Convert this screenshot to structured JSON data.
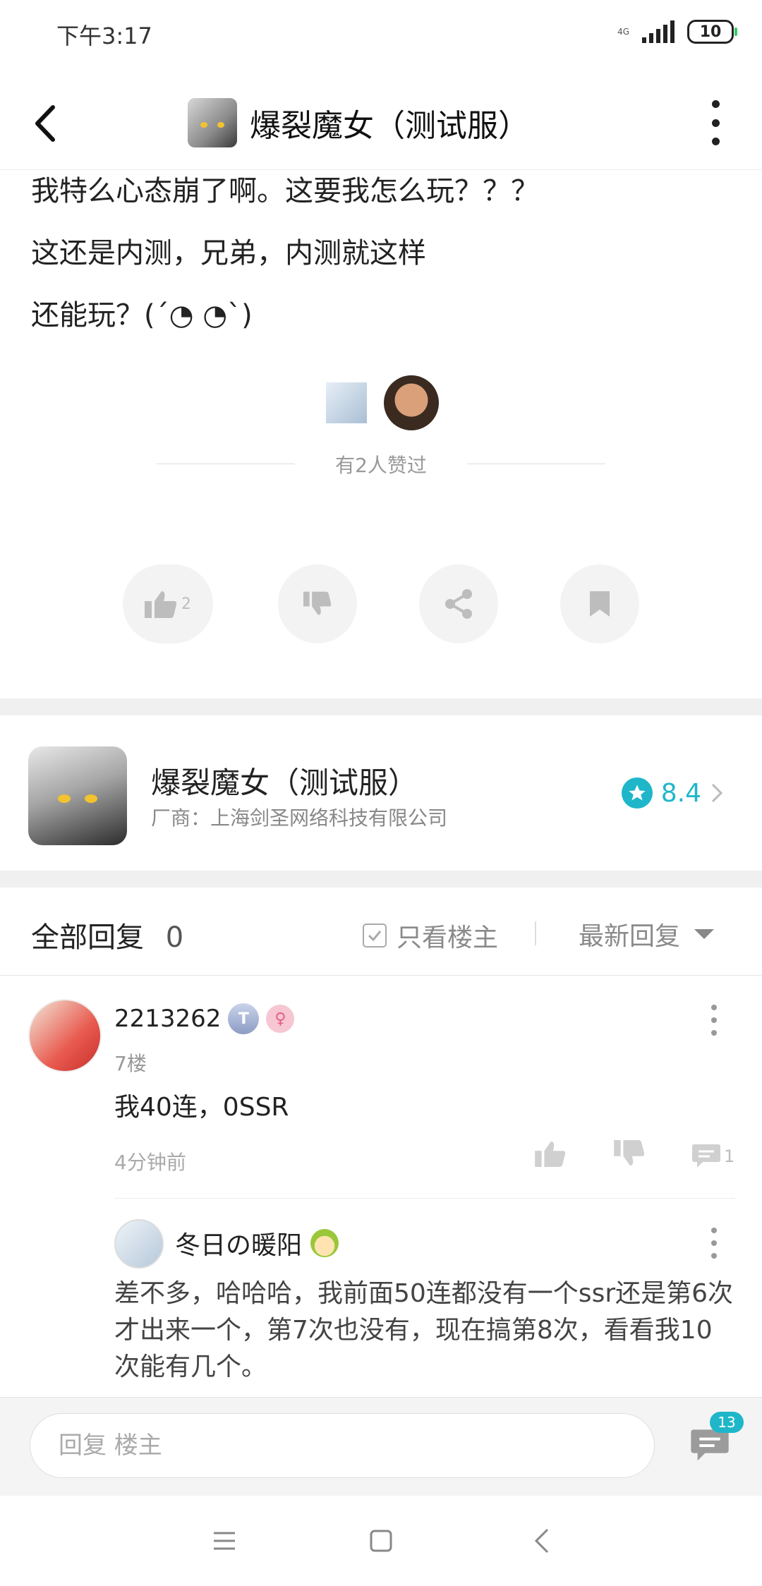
{
  "status_bar": {
    "time": "下午3:17",
    "network": "4G",
    "battery": "10"
  },
  "header": {
    "title": "爆裂魔女（测试服）"
  },
  "post": {
    "lines": [
      "我特么心态崩了啊。这要我怎么玩？？？",
      "这还是内测，兄弟，内测就这样",
      "还能玩？(´◔ ◔`)"
    ],
    "liked_text": "有2人赞过",
    "like_count": "2"
  },
  "app_card": {
    "name": "爆裂魔女（测试服）",
    "vendor": "厂商：上海剑圣网络科技有限公司",
    "rating": "8.4"
  },
  "replies_header": {
    "title": "全部回复",
    "count": "0",
    "only_host": "只看楼主",
    "sort": "最新回复"
  },
  "comment": {
    "user": "2213262",
    "badge": "T",
    "floor": "7楼",
    "text": "我40连，0SSR",
    "time": "4分钟前",
    "reply_count": "1"
  },
  "reply": {
    "user": "冬日の暖阳",
    "text": "差不多，哈哈哈，我前面50连都没有一个ssr还是第6次才出来一个，第7次也没有，现在搞第8次，看看我10次能有几个。"
  },
  "input": {
    "placeholder": "回复 楼主",
    "comments_badge": "13"
  },
  "colors": {
    "accent": "#1fb6c9"
  }
}
